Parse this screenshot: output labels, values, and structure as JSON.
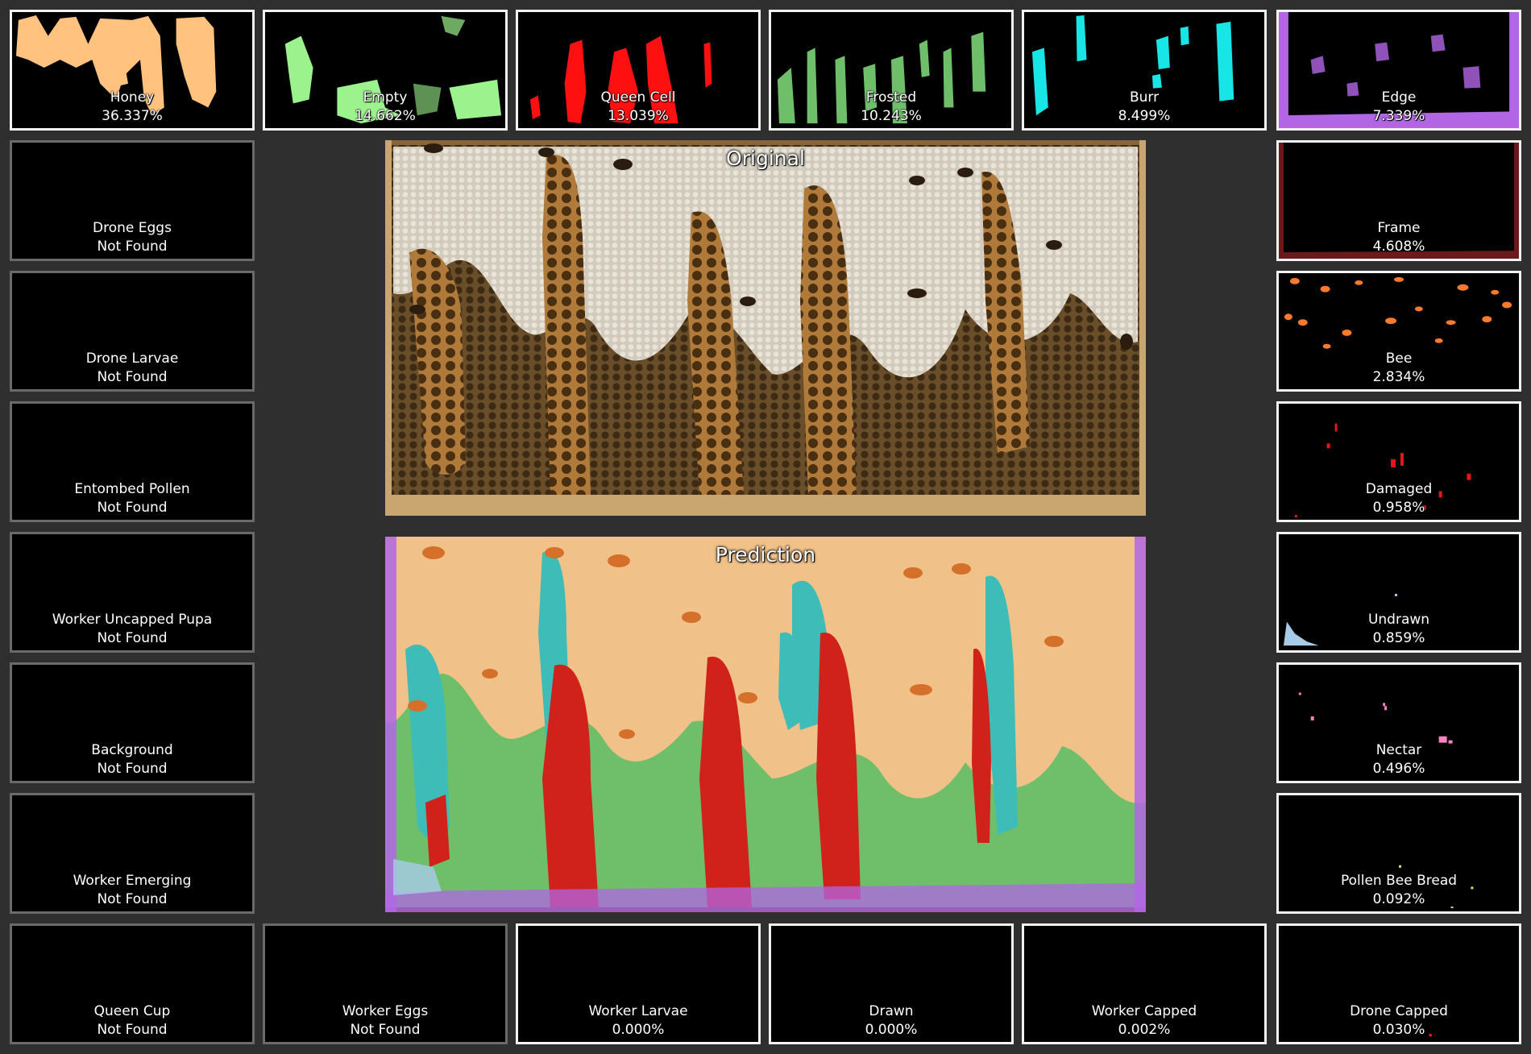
{
  "panels": {
    "original_title": "Original",
    "prediction_title": "Prediction"
  },
  "tiles": {
    "honey": {
      "label": "Honey",
      "value": "36.337%",
      "color": "#ffc27f"
    },
    "empty": {
      "label": "Empty",
      "value": "14.662%",
      "color": "#9cf28c"
    },
    "queen_cell": {
      "label": "Queen Cell",
      "value": "13.039%",
      "color": "#ff1010"
    },
    "frosted": {
      "label": "Frosted",
      "value": "10.243%",
      "color": "#6fbf6a"
    },
    "burr": {
      "label": "Burr",
      "value": "8.499%",
      "color": "#18e5e5"
    },
    "edge": {
      "label": "Edge",
      "value": "7.339%",
      "color": "#b266e6"
    },
    "drone_eggs": {
      "label": "Drone Eggs",
      "value": "Not Found"
    },
    "frame": {
      "label": "Frame",
      "value": "4.608%",
      "color": "#6a1a1a"
    },
    "drone_larvae": {
      "label": "Drone Larvae",
      "value": "Not Found"
    },
    "bee": {
      "label": "Bee",
      "value": "2.834%",
      "color": "#ff7a2a"
    },
    "entombed_pollen": {
      "label": "Entombed Pollen",
      "value": "Not Found"
    },
    "damaged": {
      "label": "Damaged",
      "value": "0.958%",
      "color": "#e01818"
    },
    "worker_uncapped_pupa": {
      "label": "Worker Uncapped Pupa",
      "value": "Not Found"
    },
    "undrawn": {
      "label": "Undrawn",
      "value": "0.859%",
      "color": "#a8cce8"
    },
    "background": {
      "label": "Background",
      "value": "Not Found"
    },
    "nectar": {
      "label": "Nectar",
      "value": "0.496%",
      "color": "#ff82c0"
    },
    "worker_emerging": {
      "label": "Worker Emerging",
      "value": "Not Found"
    },
    "pollen_bee_bread": {
      "label": "Pollen Bee Bread",
      "value": "0.092%",
      "color": "#e8e060"
    },
    "queen_cup": {
      "label": "Queen Cup",
      "value": "Not Found"
    },
    "worker_eggs": {
      "label": "Worker Eggs",
      "value": "Not Found"
    },
    "worker_larvae": {
      "label": "Worker Larvae",
      "value": "0.000%"
    },
    "drawn": {
      "label": "Drawn",
      "value": "0.000%"
    },
    "worker_capped": {
      "label": "Worker Capped",
      "value": "0.002%"
    },
    "drone_capped": {
      "label": "Drone Capped",
      "value": "0.030%",
      "color": "#ff2020"
    }
  }
}
